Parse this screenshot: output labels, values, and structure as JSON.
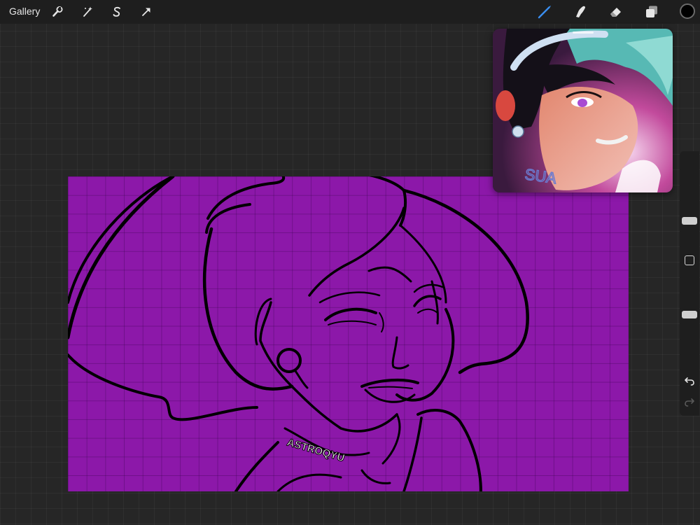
{
  "toolbar": {
    "gallery_label": "Gallery",
    "left_tools": [
      {
        "name": "actions",
        "icon": "wrench-icon"
      },
      {
        "name": "adjustments",
        "icon": "magic-wand-icon"
      },
      {
        "name": "selection",
        "icon": "selection-s-icon"
      },
      {
        "name": "transform",
        "icon": "arrow-cursor-icon"
      }
    ],
    "right_tools": [
      {
        "name": "brush",
        "icon": "brush-icon",
        "active": true
      },
      {
        "name": "smudge",
        "icon": "smudge-finger-icon"
      },
      {
        "name": "eraser",
        "icon": "eraser-icon"
      },
      {
        "name": "layers",
        "icon": "layers-icon"
      }
    ],
    "current_color": "#000000",
    "active_tool_color": "#3a8ef0"
  },
  "canvas": {
    "background_color": "#8c18a9",
    "line_color": "#000000",
    "signature": "ASTROQYU"
  },
  "reference": {
    "neck_text": "SUA"
  },
  "sidebar": {
    "brush_size": 0.24,
    "opacity": 0.5,
    "undo_icon": "undo-icon",
    "redo_icon": "redo-icon"
  }
}
